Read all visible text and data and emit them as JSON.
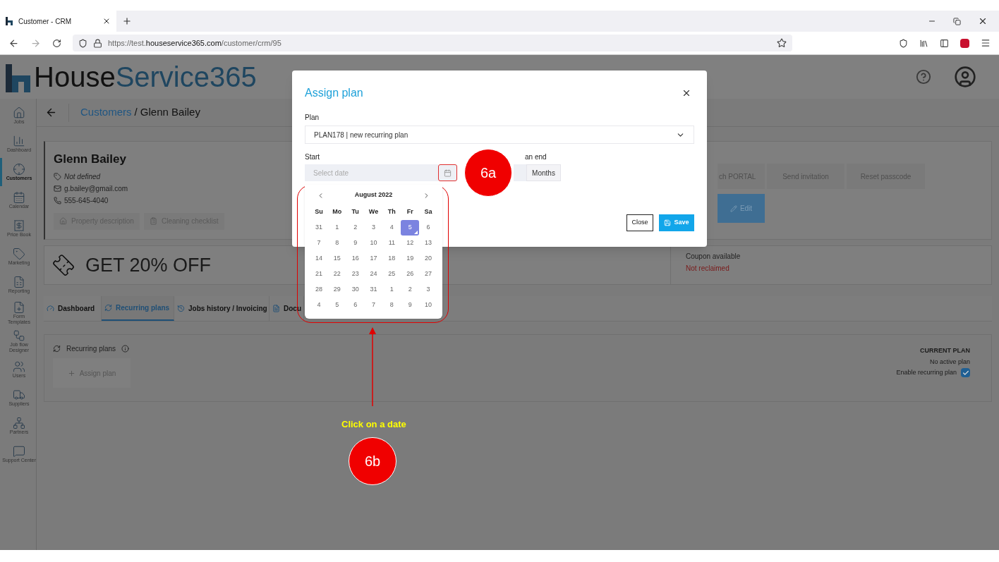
{
  "browser": {
    "tab_title": "Customer - CRM",
    "url_prefix": "https://test.",
    "url_domain": "houseservice365.com",
    "url_path": "/customer/crm/95"
  },
  "app": {
    "logo_a": "House",
    "logo_b": "Service365",
    "sidebar": [
      {
        "label": "Jobs",
        "selected": false
      },
      {
        "label": "Dashboard",
        "selected": false
      },
      {
        "label": "Customers",
        "selected": true
      },
      {
        "label": "Calendar",
        "selected": false
      },
      {
        "label": "Price Book",
        "selected": false
      },
      {
        "label": "Marketing",
        "selected": false
      },
      {
        "label": "Reporting",
        "selected": false
      },
      {
        "label": "Form Templates",
        "selected": false
      },
      {
        "label": "Job flow Designer",
        "selected": false
      },
      {
        "label": "Users",
        "selected": false
      },
      {
        "label": "Suppliers",
        "selected": false
      },
      {
        "label": "Partners",
        "selected": false
      },
      {
        "label": "Support Center",
        "selected": false
      }
    ],
    "breadcrumb": {
      "link": "Customers",
      "current": "/ Glenn Bailey"
    },
    "customer": {
      "name": "Glenn Bailey",
      "tag": "Not defined",
      "email": "g.bailey@gmail.com",
      "phone": "555-645-4040",
      "buttons": [
        "Property description",
        "Cleaning checklist"
      ]
    },
    "portal_buttons": [
      "ch PORTAL",
      "Send invitation",
      "Reset passcode"
    ],
    "edit_button": "Edit",
    "promo": "GET 20% OFF",
    "coupon": {
      "label": "Coupon available",
      "status": "Not reclaimed"
    },
    "tabs": [
      {
        "label": "Dashboard",
        "selected": false
      },
      {
        "label": "Recurring plans",
        "selected": true
      },
      {
        "label": "Jobs history / Invoicing",
        "selected": false
      },
      {
        "label": "Docu",
        "selected": false
      }
    ],
    "recurring": {
      "title": "Recurring plans",
      "assign_button": "Assign plan"
    },
    "current_plan": {
      "heading": "CURRENT PLAN",
      "status": "No active plan",
      "enable_label": "Enable recurring plan",
      "checked": true
    }
  },
  "modal": {
    "title": "Assign plan",
    "plan_label": "Plan",
    "plan_value": "PLAN178 | new recurring plan",
    "start_label": "Start",
    "start_placeholder": "Select date",
    "end_label": "an end",
    "end_unit": "Months",
    "close": "Close",
    "save": "Save"
  },
  "calendar": {
    "month": "August 2022",
    "weekdays": [
      "Su",
      "Mo",
      "Tu",
      "We",
      "Th",
      "Fr",
      "Sa"
    ],
    "weeks": [
      [
        {
          "day": "31",
          "selected": false
        },
        {
          "day": "1",
          "selected": false
        },
        {
          "day": "2",
          "selected": false
        },
        {
          "day": "3",
          "selected": false
        },
        {
          "day": "4",
          "selected": false
        },
        {
          "day": "5",
          "selected": true
        },
        {
          "day": "6",
          "selected": false
        }
      ],
      [
        {
          "day": "7",
          "selected": false
        },
        {
          "day": "8",
          "selected": false
        },
        {
          "day": "9",
          "selected": false
        },
        {
          "day": "10",
          "selected": false
        },
        {
          "day": "11",
          "selected": false
        },
        {
          "day": "12",
          "selected": false
        },
        {
          "day": "13",
          "selected": false
        }
      ],
      [
        {
          "day": "14",
          "selected": false
        },
        {
          "day": "15",
          "selected": false
        },
        {
          "day": "16",
          "selected": false
        },
        {
          "day": "17",
          "selected": false
        },
        {
          "day": "18",
          "selected": false
        },
        {
          "day": "19",
          "selected": false
        },
        {
          "day": "20",
          "selected": false
        }
      ],
      [
        {
          "day": "21",
          "selected": false
        },
        {
          "day": "22",
          "selected": false
        },
        {
          "day": "23",
          "selected": false
        },
        {
          "day": "24",
          "selected": false
        },
        {
          "day": "25",
          "selected": false
        },
        {
          "day": "26",
          "selected": false
        },
        {
          "day": "27",
          "selected": false
        }
      ],
      [
        {
          "day": "28",
          "selected": false
        },
        {
          "day": "29",
          "selected": false
        },
        {
          "day": "30",
          "selected": false
        },
        {
          "day": "31",
          "selected": false
        },
        {
          "day": "1",
          "selected": false
        },
        {
          "day": "2",
          "selected": false
        },
        {
          "day": "3",
          "selected": false
        }
      ],
      [
        {
          "day": "4",
          "selected": false
        },
        {
          "day": "5",
          "selected": false
        },
        {
          "day": "6",
          "selected": false
        },
        {
          "day": "7",
          "selected": false
        },
        {
          "day": "8",
          "selected": false
        },
        {
          "day": "9",
          "selected": false
        },
        {
          "day": "10",
          "selected": false
        }
      ]
    ]
  },
  "annotations": {
    "badges": [
      "6a",
      "6b"
    ],
    "hint": "Click on a date"
  }
}
